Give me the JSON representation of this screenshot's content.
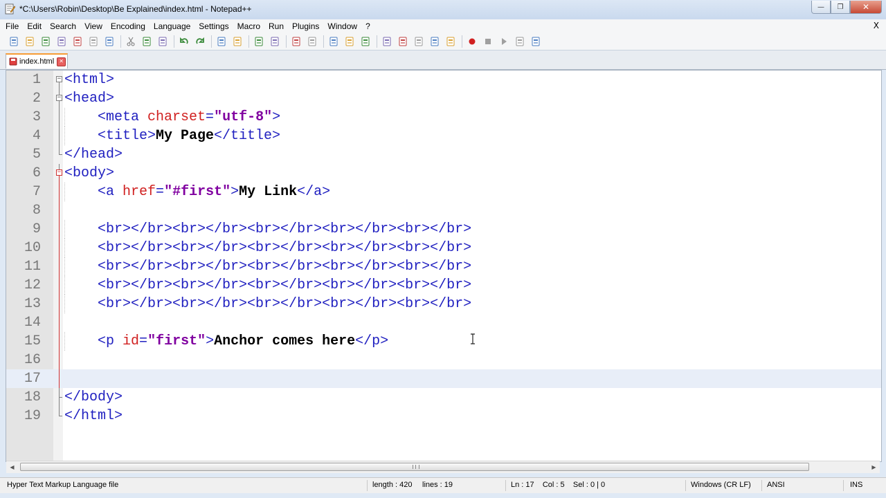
{
  "window": {
    "title": "*C:\\Users\\Robin\\Desktop\\Be Explained\\index.html - Notepad++",
    "minimize": "—",
    "maximize": "❐",
    "close": "✕"
  },
  "menu": {
    "items": [
      "File",
      "Edit",
      "Search",
      "View",
      "Encoding",
      "Language",
      "Settings",
      "Macro",
      "Run",
      "Plugins",
      "Window",
      "?"
    ],
    "close_label": "X"
  },
  "tabs": [
    {
      "label": "index.html",
      "modified": true
    }
  ],
  "editor": {
    "lines": [
      {
        "num": "1",
        "fold": "open",
        "tokens": [
          {
            "t": "tag",
            "v": "<html>"
          }
        ]
      },
      {
        "num": "2",
        "fold": "open",
        "tokens": [
          {
            "t": "tag",
            "v": "<head>"
          }
        ]
      },
      {
        "num": "3",
        "fold": "line",
        "tokens": [
          {
            "t": "plain",
            "v": "    "
          },
          {
            "t": "tag",
            "v": "<meta "
          },
          {
            "t": "attr",
            "v": "charset"
          },
          {
            "t": "tag",
            "v": "="
          },
          {
            "t": "val",
            "v": "\"utf-8\""
          },
          {
            "t": "tag",
            "v": ">"
          }
        ]
      },
      {
        "num": "4",
        "fold": "line",
        "tokens": [
          {
            "t": "plain",
            "v": "    "
          },
          {
            "t": "tag",
            "v": "<title>"
          },
          {
            "t": "txt",
            "v": "My Page"
          },
          {
            "t": "tag",
            "v": "</title>"
          }
        ]
      },
      {
        "num": "5",
        "fold": "end",
        "tokens": [
          {
            "t": "tag",
            "v": "</head>"
          }
        ]
      },
      {
        "num": "6",
        "fold": "open-red",
        "tokens": [
          {
            "t": "tag",
            "v": "<body>"
          }
        ]
      },
      {
        "num": "7",
        "fold": "line-red",
        "tokens": [
          {
            "t": "plain",
            "v": "    "
          },
          {
            "t": "tag",
            "v": "<a "
          },
          {
            "t": "attr",
            "v": "href"
          },
          {
            "t": "tag",
            "v": "="
          },
          {
            "t": "val",
            "v": "\"#first\""
          },
          {
            "t": "tag",
            "v": ">"
          },
          {
            "t": "txt",
            "v": "My Link"
          },
          {
            "t": "tag",
            "v": "</a>"
          }
        ]
      },
      {
        "num": "8",
        "fold": "line-red",
        "tokens": []
      },
      {
        "num": "9",
        "fold": "line-red",
        "tokens": [
          {
            "t": "plain",
            "v": "    "
          },
          {
            "t": "tag",
            "v": "<br></br><br></br><br></br><br></br><br></br>"
          }
        ]
      },
      {
        "num": "10",
        "fold": "line-red",
        "tokens": [
          {
            "t": "plain",
            "v": "    "
          },
          {
            "t": "tag",
            "v": "<br></br><br></br><br></br><br></br><br></br>"
          }
        ]
      },
      {
        "num": "11",
        "fold": "line-red",
        "tokens": [
          {
            "t": "plain",
            "v": "    "
          },
          {
            "t": "tag",
            "v": "<br></br><br></br><br></br><br></br><br></br>"
          }
        ]
      },
      {
        "num": "12",
        "fold": "line-red",
        "tokens": [
          {
            "t": "plain",
            "v": "    "
          },
          {
            "t": "tag",
            "v": "<br></br><br></br><br></br><br></br><br></br>"
          }
        ]
      },
      {
        "num": "13",
        "fold": "line-red",
        "tokens": [
          {
            "t": "plain",
            "v": "    "
          },
          {
            "t": "tag",
            "v": "<br></br><br></br><br></br><br></br><br></br>"
          }
        ]
      },
      {
        "num": "14",
        "fold": "line-red",
        "tokens": []
      },
      {
        "num": "15",
        "fold": "line-red",
        "tokens": [
          {
            "t": "plain",
            "v": "    "
          },
          {
            "t": "tag",
            "v": "<p "
          },
          {
            "t": "attr",
            "v": "id"
          },
          {
            "t": "tag",
            "v": "="
          },
          {
            "t": "val",
            "v": "\"first\""
          },
          {
            "t": "tag",
            "v": ">"
          },
          {
            "t": "txt",
            "v": "Anchor comes here"
          },
          {
            "t": "tag",
            "v": "</p>"
          }
        ]
      },
      {
        "num": "16",
        "fold": "line-red",
        "tokens": []
      },
      {
        "num": "17",
        "fold": "line-red",
        "tokens": [],
        "current": true
      },
      {
        "num": "18",
        "fold": "end-red",
        "tokens": [
          {
            "t": "tag",
            "v": "</body>"
          }
        ]
      },
      {
        "num": "19",
        "fold": "end",
        "tokens": [
          {
            "t": "tag",
            "v": "</html>"
          }
        ]
      }
    ]
  },
  "status": {
    "file_type": "Hyper Text Markup Language file",
    "length": "length : 420",
    "lines": "lines : 19",
    "position": "Ln : 17    Col : 5    Sel : 0 | 0",
    "eol": "Windows (CR LF)",
    "encoding": "ANSI",
    "mode": "INS"
  },
  "colors": {
    "tag": "#2020c0",
    "attribute": "#d02020",
    "value": "#8000a0",
    "current_line": "#e8eef8",
    "tab_accent": "#f79c35"
  },
  "toolbar_icons": [
    "new-file-icon",
    "open-file-icon",
    "save-icon",
    "save-all-icon",
    "close-icon",
    "close-all-icon",
    "print-icon",
    "cut-icon",
    "copy-icon",
    "paste-icon",
    "undo-icon",
    "redo-icon",
    "find-icon",
    "replace-icon",
    "zoom-in-icon",
    "zoom-out-icon",
    "sync-vertical-icon",
    "sync-horizontal-icon",
    "word-wrap-icon",
    "show-all-chars-icon",
    "indent-guide-icon",
    "udl-icon",
    "doc-map-icon",
    "function-list-icon",
    "folder-workspace-icon",
    "monitoring-icon",
    "record-macro-icon",
    "stop-macro-icon",
    "play-macro-icon",
    "run-macro-multiple-icon",
    "save-macro-icon"
  ]
}
